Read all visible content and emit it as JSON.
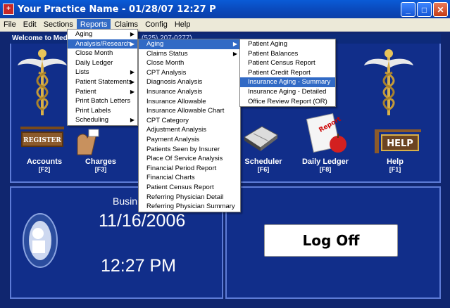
{
  "window": {
    "title": "Your Practice Name  -  01/28/07 12:27 P",
    "app_icon": "practice-app-icon"
  },
  "menubar": [
    "File",
    "Edit",
    "Sections",
    "Reports",
    "Claims",
    "Config",
    "Help"
  ],
  "welcome": "Welcome to Medi",
  "phone_fragment": "(525) 207-0277)",
  "icons": {
    "accounts": {
      "label": "Accounts",
      "key": "[F2]",
      "icon": "register-sign-icon"
    },
    "charges": {
      "label": "Charges",
      "key": "[F3]",
      "icon": "hand-charge-icon"
    },
    "scheduler": {
      "label": "Scheduler",
      "key": "[F6]",
      "icon": "scheduler-book-icon"
    },
    "daily_ledger": {
      "label": "Daily Ledger",
      "key": "[F8]",
      "icon": "report-apple-icon"
    },
    "help": {
      "label": "Help",
      "key": "[F1]",
      "icon": "help-sign-icon"
    }
  },
  "business": {
    "label": "Busin",
    "date": "11/16/2006",
    "time": "12:27 PM"
  },
  "logoff_label": "Log Off",
  "reports_menu": [
    {
      "label": "Aging",
      "submenu": true
    },
    {
      "label": "Analysis/Research",
      "submenu": true,
      "selected": true
    },
    {
      "label": "Close Month"
    },
    {
      "label": "Daily Ledger"
    },
    {
      "label": "Lists",
      "submenu": true
    },
    {
      "label": "Patient Statements",
      "submenu": true
    },
    {
      "label": "Patient",
      "submenu": true
    },
    {
      "label": "Print Batch Letters"
    },
    {
      "label": "Print Labels"
    },
    {
      "label": "Scheduling",
      "submenu": true
    }
  ],
  "analysis_menu": [
    {
      "label": "Aging",
      "submenu": true,
      "selected": true
    },
    {
      "label": "Claims Status",
      "submenu": true
    },
    {
      "label": "Close Month"
    },
    {
      "label": "CPT Analysis"
    },
    {
      "label": "Diagnosis Analysis"
    },
    {
      "label": "Insurance Analysis"
    },
    {
      "label": "Insurance Allowable"
    },
    {
      "label": "Insurance Allowable Chart"
    },
    {
      "label": "CPT Category"
    },
    {
      "label": "Adjustment Analysis"
    },
    {
      "label": "Payment Analysis"
    },
    {
      "label": "Patients Seen by Insurer"
    },
    {
      "label": "Place Of Service Analysis"
    },
    {
      "label": "Financial Period Report"
    },
    {
      "label": "Financial Charts"
    },
    {
      "label": "Patient Census Report"
    },
    {
      "label": "Referring Physician Detail"
    },
    {
      "label": "Referring Physician Summary"
    }
  ],
  "aging_menu": [
    {
      "label": "Patient Aging"
    },
    {
      "label": "Patient Balances"
    },
    {
      "label": "Patient Census Report"
    },
    {
      "label": "Patient Credit Report"
    },
    {
      "label": "Insurance Aging - Summary",
      "selected": true
    },
    {
      "label": "Insurance Aging - Detailed"
    },
    {
      "label": "Office Review Report (OR)"
    }
  ],
  "colors": {
    "title_bar": "#0a47b9",
    "menu_highlight": "#316ac5",
    "panel": "#112e8a",
    "panel_border": "#5d7bd6"
  }
}
